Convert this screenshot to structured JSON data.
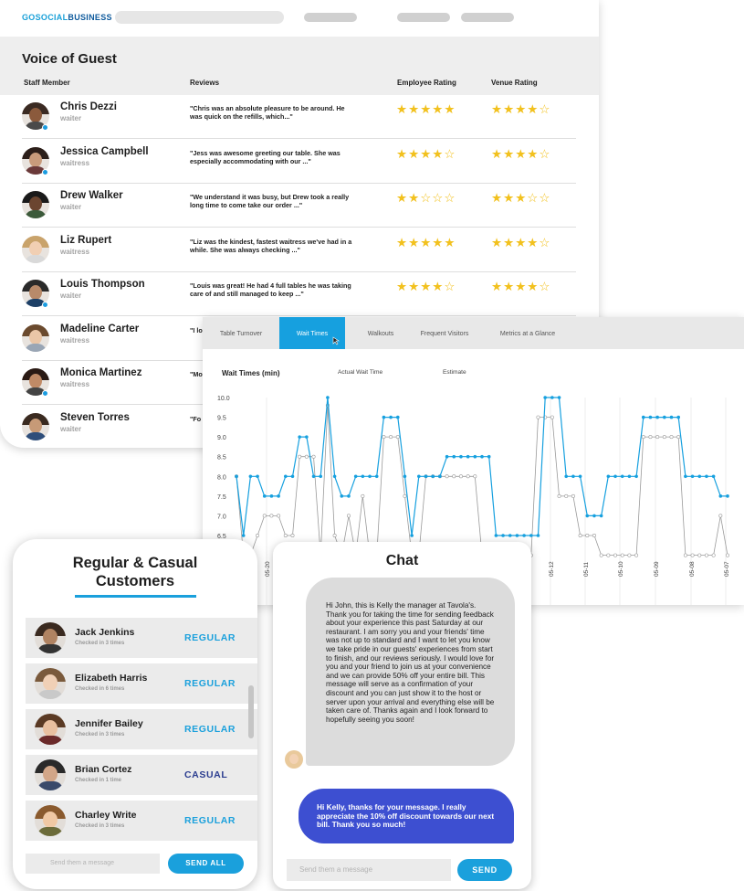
{
  "brand": {
    "part1": "GOSOCIAL",
    "part2": "BUSINESS"
  },
  "voice_of_guest": {
    "title": "Voice of Guest",
    "columns": {
      "staff": "Staff Member",
      "reviews": "Reviews",
      "employee_rating": "Employee Rating",
      "venue_rating": "Venue Rating"
    },
    "rows": [
      {
        "name": "Chris Dezzi",
        "role": "waiter",
        "review": "\"Chris was an absolute pleasure to be around. He was quick on the refills, which...\"",
        "employee_rating": 5,
        "venue_rating": 4,
        "online": true
      },
      {
        "name": "Jessica Campbell",
        "role": "waitress",
        "review": "\"Jess was awesome greeting our table. She was especially accommodating with our ...\"",
        "employee_rating": 4,
        "venue_rating": 4,
        "online": true
      },
      {
        "name": "Drew Walker",
        "role": "waiter",
        "review": "\"We understand it was busy, but Drew took a really long time to come take our order ...\"",
        "employee_rating": 2,
        "venue_rating": 3,
        "online": false
      },
      {
        "name": "Liz Rupert",
        "role": "waitress",
        "review": "\"Liz was the kindest, fastest waitress we've had in a while. She was always checking ...\"",
        "employee_rating": 5,
        "venue_rating": 4,
        "online": false
      },
      {
        "name": "Louis Thompson",
        "role": "waiter",
        "review": "\"Louis was great! He had 4 full tables he was taking care of and still managed to keep ...\"",
        "employee_rating": 4,
        "venue_rating": 4,
        "online": true
      },
      {
        "name": "Madeline Carter",
        "role": "waitress",
        "review": "\"I lo you",
        "employee_rating": null,
        "venue_rating": null,
        "online": false
      },
      {
        "name": "Monica Martinez",
        "role": "waitress",
        "review": "\"Mo atti",
        "employee_rating": null,
        "venue_rating": null,
        "online": true
      },
      {
        "name": "Steven Torres",
        "role": "waiter",
        "review": "\"Fo and",
        "employee_rating": null,
        "venue_rating": null,
        "online": false
      }
    ]
  },
  "chart_tabs": [
    "Table Turnover",
    "Wait Times",
    "Walkouts",
    "Frequent Visitors",
    "Metrics at a Glance"
  ],
  "active_tab": "Wait Times",
  "chart_data": {
    "type": "line",
    "title": "Wait Times (min)",
    "ylim": [
      6.5,
      10.0
    ],
    "y_ticks": [
      "10.0",
      "9.5",
      "9.0",
      "8.5",
      "8.0",
      "7.5",
      "7.0",
      "6.5"
    ],
    "x_tick_labels": [
      "05-20",
      "05-12",
      "05-11",
      "05-10",
      "05-09",
      "05-08",
      "05-07"
    ],
    "grid": "vertical",
    "series": [
      {
        "name": "Actual Wait Time",
        "color": "#16a0df",
        "values": [
          8.0,
          6.5,
          8.0,
          8.0,
          7.5,
          7.5,
          7.5,
          8.0,
          8.0,
          9.0,
          9.0,
          8.0,
          8.0,
          10.0,
          8.0,
          7.5,
          7.5,
          8.0,
          8.0,
          8.0,
          8.0,
          9.5,
          9.5,
          9.5,
          8.0,
          6.5,
          8.0,
          8.0,
          8.0,
          8.0,
          8.5,
          8.5,
          8.5,
          8.5,
          8.5,
          8.5,
          8.5,
          6.5,
          6.5,
          6.5,
          6.5,
          6.5,
          6.5,
          6.5,
          10.0,
          10.0,
          10.0,
          8.0,
          8.0,
          8.0,
          7.0,
          7.0,
          7.0,
          8.0,
          8.0,
          8.0,
          8.0,
          8.0,
          9.5,
          9.5,
          9.5,
          9.5,
          9.5,
          9.5,
          8.0,
          8.0,
          8.0,
          8.0,
          8.0,
          7.5,
          7.5
        ]
      },
      {
        "name": "Estimate",
        "color": "#9a9a9a",
        "values": [
          8.0,
          6.0,
          6.0,
          6.5,
          7.0,
          7.0,
          7.0,
          6.5,
          6.5,
          8.5,
          8.5,
          8.5,
          6.0,
          9.8,
          6.5,
          6.0,
          7.0,
          6.0,
          7.5,
          6.0,
          6.0,
          9.0,
          9.0,
          9.0,
          7.5,
          6.0,
          6.0,
          8.0,
          8.0,
          8.0,
          8.0,
          8.0,
          8.0,
          8.0,
          8.0,
          6.0,
          6.0,
          6.0,
          6.0,
          6.0,
          6.0,
          6.0,
          6.0,
          9.5,
          9.5,
          9.5,
          7.5,
          7.5,
          7.5,
          6.5,
          6.5,
          6.5,
          6.0,
          6.0,
          6.0,
          6.0,
          6.0,
          6.0,
          9.0,
          9.0,
          9.0,
          9.0,
          9.0,
          9.0,
          6.0,
          6.0,
          6.0,
          6.0,
          6.0,
          7.0,
          6.0
        ]
      }
    ]
  },
  "regular_casual": {
    "title_line1": "Regular & Casual",
    "title_line2": "Customers",
    "customers": [
      {
        "name": "Jack Jenkins",
        "meta": "Checked in 3 times",
        "type": "REGULAR"
      },
      {
        "name": "Elizabeth Harris",
        "meta": "Checked in 6 times",
        "type": "REGULAR"
      },
      {
        "name": "Jennifer Bailey",
        "meta": "Checked in 3 times",
        "type": "REGULAR"
      },
      {
        "name": "Brian Cortez",
        "meta": "Checked in 1 time",
        "type": "CASUAL"
      },
      {
        "name": "Charley Write",
        "meta": "Checked in 3 times",
        "type": "REGULAR"
      }
    ],
    "input_placeholder": "Send them a message",
    "send_all_label": "SEND ALL"
  },
  "chat": {
    "title": "Chat",
    "incoming": "Hi John, this is Kelly the manager at Tavola's. Thank you for taking the time for sending feedback about your experience this past Saturday at our restaurant. I am sorry you and your friends' time was not up to standard and I want to let you know we take pride in our guests' experiences from start to finish, and our reviews seriously. I would love for you and your friend to join us at your convenience and we can provide 50% off your entire bill. This message will serve as a confirmation of your discount and you can just show it to the host or server upon your arrival and everything else will be taken care of. Thanks again and I look forward to hopefully seeing you soon!",
    "outgoing": "Hi Kelly, thanks for your message. I really appreciate the 10% off discount towards our next bill. Thank you so much!",
    "input_placeholder": "Send them a message",
    "send_label": "SEND"
  }
}
